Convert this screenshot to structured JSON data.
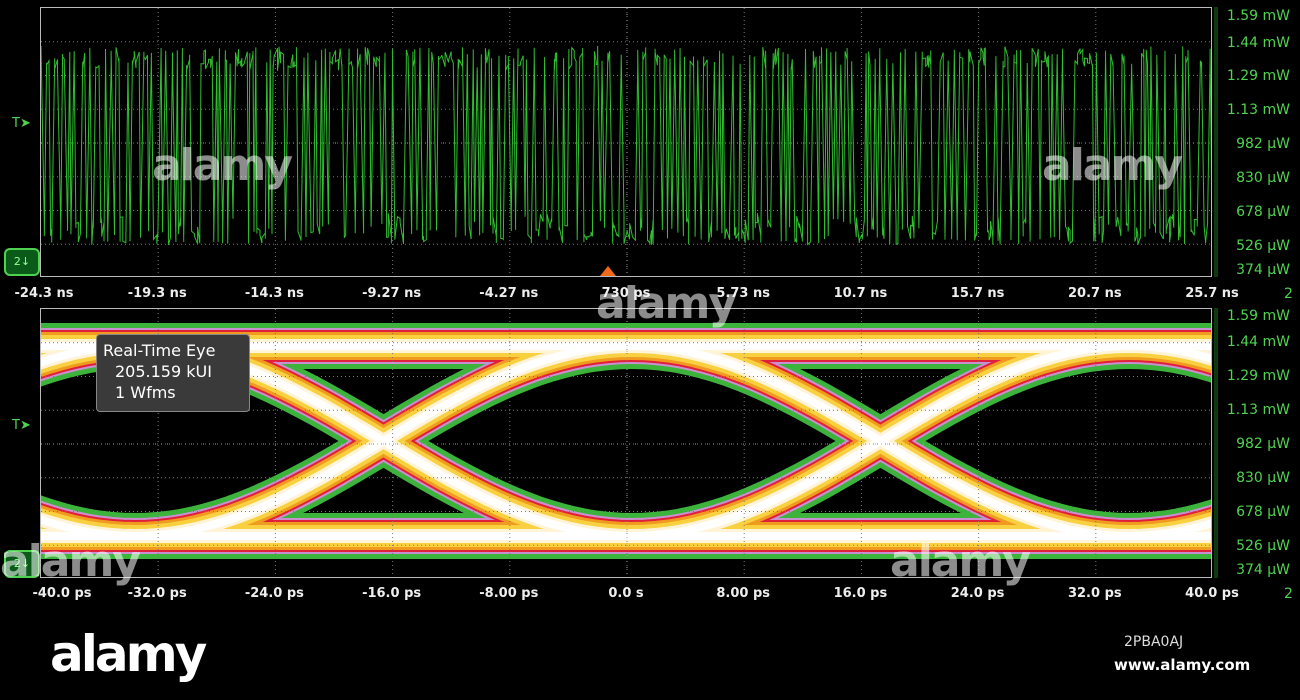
{
  "top_plot": {
    "x_labels": [
      "-24.3 ns",
      "-19.3 ns",
      "-14.3 ns",
      "-9.27 ns",
      "-4.27 ns",
      "730 ps",
      "5.73 ns",
      "10.7 ns",
      "15.7 ns",
      "20.7 ns",
      "25.7 ns"
    ],
    "y_labels": [
      "1.59 mW",
      "1.44 mW",
      "1.29 mW",
      "1.13 mW",
      "982 µW",
      "830 µW",
      "678 µW",
      "526 µW",
      "374 µW"
    ],
    "trigger_marker": "T",
    "channel": "2",
    "channel_right": "2",
    "waveform_color": "#2fbf2f"
  },
  "bottom_plot": {
    "x_labels": [
      "-40.0 ps",
      "-32.0 ps",
      "-24.0 ps",
      "-16.0 ps",
      "-8.00 ps",
      "0.0 s",
      "8.00 ps",
      "16.0 ps",
      "24.0 ps",
      "32.0 ps",
      "40.0 ps"
    ],
    "y_labels": [
      "1.59 mW",
      "1.44 mW",
      "1.29 mW",
      "1.13 mW",
      "982 µW",
      "830 µW",
      "678 µW",
      "526 µW",
      "374 µW"
    ],
    "trigger_marker": "T",
    "channel": "2",
    "channel_right": "2",
    "overlay": {
      "title": "Real-Time Eye",
      "ui_count": "205.159 kUI",
      "waveforms": "1 Wfms"
    }
  },
  "watermark": {
    "brand": "alamy",
    "image_id": "2PBA0AJ",
    "url": "www.alamy.com"
  }
}
